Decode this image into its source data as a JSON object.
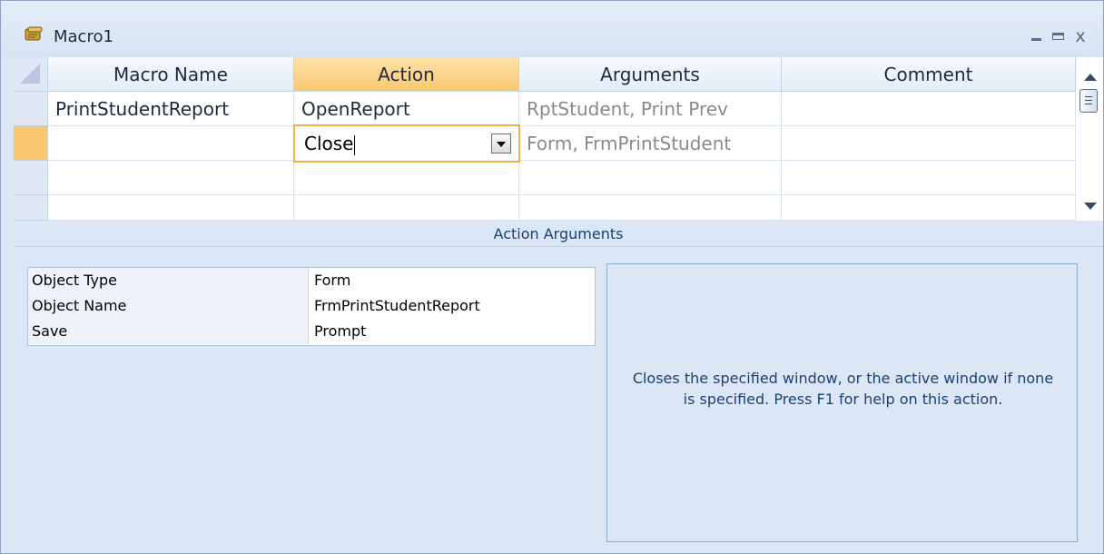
{
  "window": {
    "title": "Macro1",
    "minimize_glyph": "_",
    "close_glyph": "x"
  },
  "grid": {
    "columns": [
      "Macro Name",
      "Action",
      "Arguments",
      "Comment"
    ],
    "active_column": "Action",
    "rows": [
      {
        "macro_name": "PrintStudentReport",
        "action": "OpenReport",
        "arguments": "RptStudent, Print Prev",
        "comment": ""
      },
      {
        "macro_name": "",
        "action": "Close",
        "arguments": "Form, FrmPrintStudent",
        "comment": ""
      },
      {
        "macro_name": "",
        "action": "",
        "arguments": "",
        "comment": ""
      },
      {
        "macro_name": "",
        "action": "",
        "arguments": "",
        "comment": ""
      }
    ]
  },
  "action_arguments": {
    "title": "Action Arguments",
    "properties": [
      {
        "label": "Object Type",
        "value": "Form"
      },
      {
        "label": "Object Name",
        "value": "FrmPrintStudentReport"
      },
      {
        "label": "Save",
        "value": "Prompt"
      }
    ],
    "help_text": "Closes the specified window, or the active window if none is specified. Press F1 for help on this action."
  },
  "colors": {
    "active_header": "#f9c871",
    "edit_border": "#f3b04a",
    "panel_bg": "#dce7f5",
    "heading_text": "#1d3f73"
  },
  "icons": {
    "title_icon": "macro-scroll-icon",
    "dropdown": "chevron-down-icon"
  }
}
